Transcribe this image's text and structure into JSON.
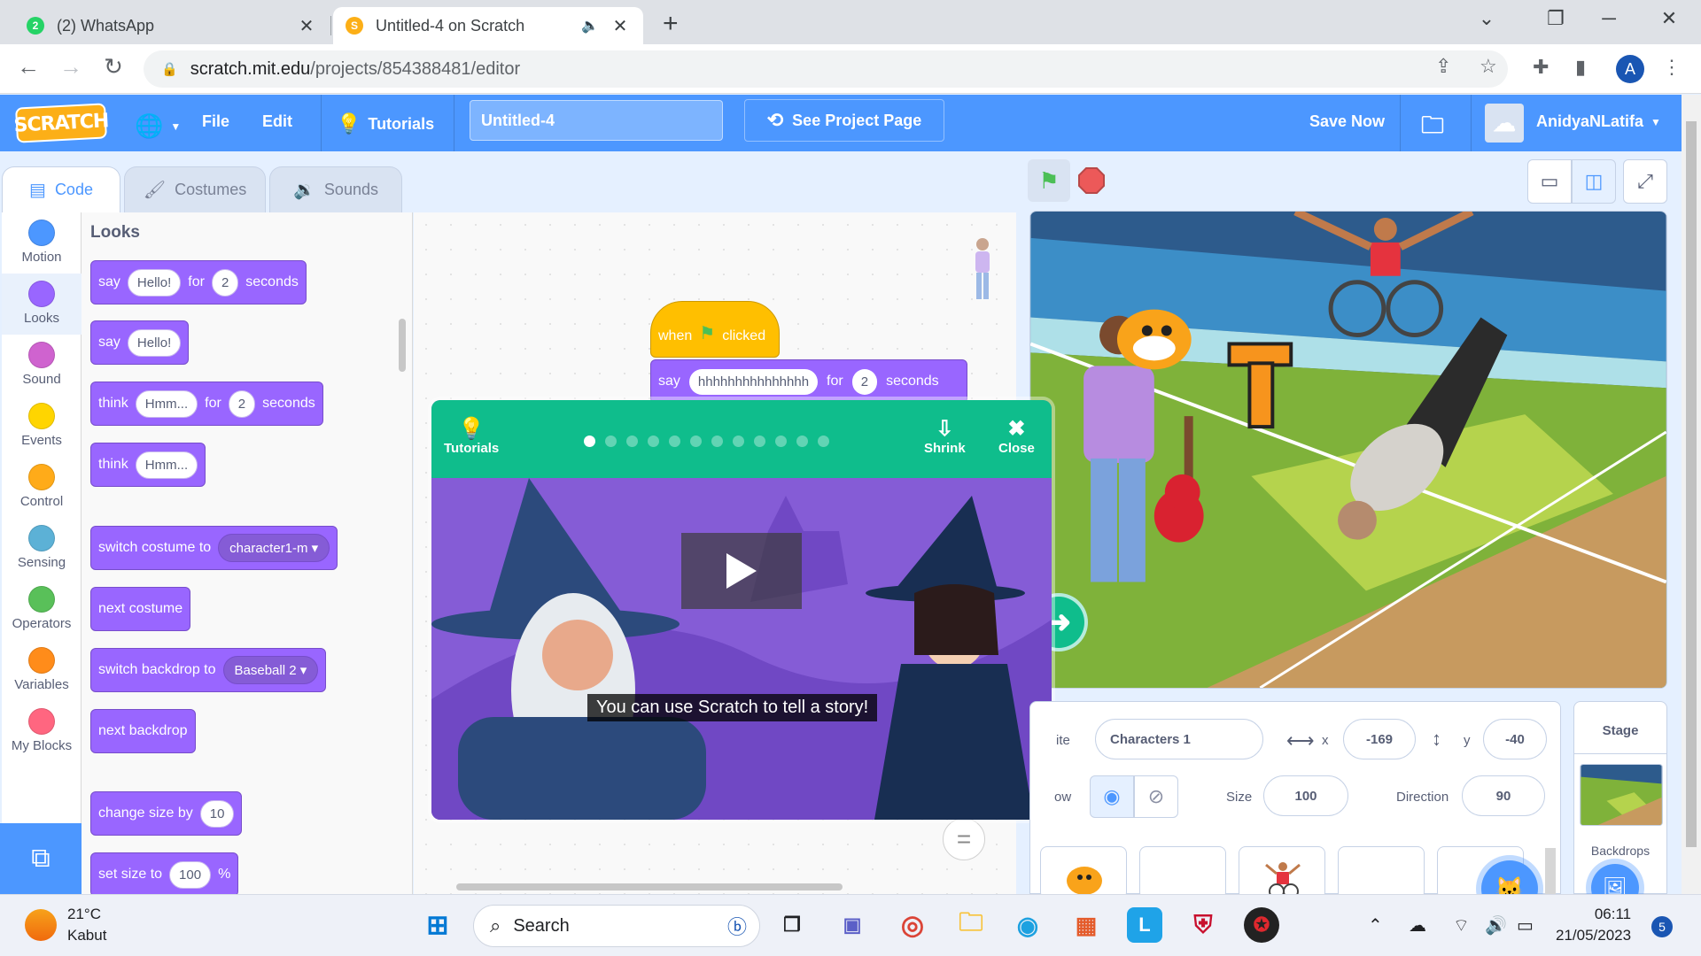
{
  "browser": {
    "tabs": [
      {
        "title": "(2) WhatsApp",
        "badge": "2"
      },
      {
        "title": "Untitled-4 on Scratch"
      }
    ],
    "url_domain": "scratch.mit.edu",
    "url_path": "/projects/854388481/editor",
    "profile_initial": "A"
  },
  "menu": {
    "logo": "SCRATCH",
    "file": "File",
    "edit": "Edit",
    "tutorials": "Tutorials",
    "project_title": "Untitled-4",
    "see_project_page": "See Project Page",
    "save_now": "Save Now",
    "username": "AnidyaNLatifa"
  },
  "editor_tabs": {
    "code": "Code",
    "costumes": "Costumes",
    "sounds": "Sounds"
  },
  "categories": [
    {
      "label": "Motion",
      "color": "#4c97ff"
    },
    {
      "label": "Looks",
      "color": "#9966ff"
    },
    {
      "label": "Sound",
      "color": "#cf63cf"
    },
    {
      "label": "Events",
      "color": "#ffd500"
    },
    {
      "label": "Control",
      "color": "#ffab19"
    },
    {
      "label": "Sensing",
      "color": "#5cb1d6"
    },
    {
      "label": "Operators",
      "color": "#59c059"
    },
    {
      "label": "Variables",
      "color": "#ff8c1a"
    },
    {
      "label": "My Blocks",
      "color": "#ff6680"
    }
  ],
  "palette": {
    "heading": "Looks",
    "b1": {
      "say": "say",
      "msg": "Hello!",
      "for": "for",
      "secs": "2",
      "seconds": "seconds"
    },
    "b2": {
      "say": "say",
      "msg": "Hello!"
    },
    "b3": {
      "think": "think",
      "msg": "Hmm...",
      "for": "for",
      "secs": "2",
      "seconds": "seconds"
    },
    "b4": {
      "think": "think",
      "msg": "Hmm..."
    },
    "b5": {
      "label": "switch costume to",
      "value": "character1-m"
    },
    "b6": {
      "label": "next costume"
    },
    "b7": {
      "label": "switch backdrop to",
      "value": "Baseball 2"
    },
    "b8": {
      "label": "next backdrop"
    },
    "b9": {
      "label": "change size by",
      "value": "10"
    },
    "b10": {
      "label": "set size to",
      "value": "100",
      "unit": "%"
    }
  },
  "script": {
    "when": "when",
    "clicked": "clicked",
    "say": "say",
    "message": "hhhhhhhhhhhhhhh",
    "for": "for",
    "secs": "2",
    "seconds": "seconds"
  },
  "tutorial_modal": {
    "tutorials": "Tutorials",
    "shrink": "Shrink",
    "close": "Close",
    "step_count": 12,
    "current_step": 1,
    "caption": "You can use Scratch to tell a story!"
  },
  "sprite_info": {
    "sprite_label": "ite",
    "sprite_name": "Characters 1",
    "x_label": "x",
    "x": "-169",
    "y_label": "y",
    "y": "-40",
    "show_label": "ow",
    "size_label": "Size",
    "size": "100",
    "direction_label": "Direction",
    "direction": "90"
  },
  "stage_pane": {
    "title": "Stage",
    "backdrops": "Backdrops"
  },
  "taskbar": {
    "temperature": "21°C",
    "weather": "Kabut",
    "search": "Search",
    "time": "06:11",
    "date": "21/05/2023",
    "notifications": "5"
  }
}
